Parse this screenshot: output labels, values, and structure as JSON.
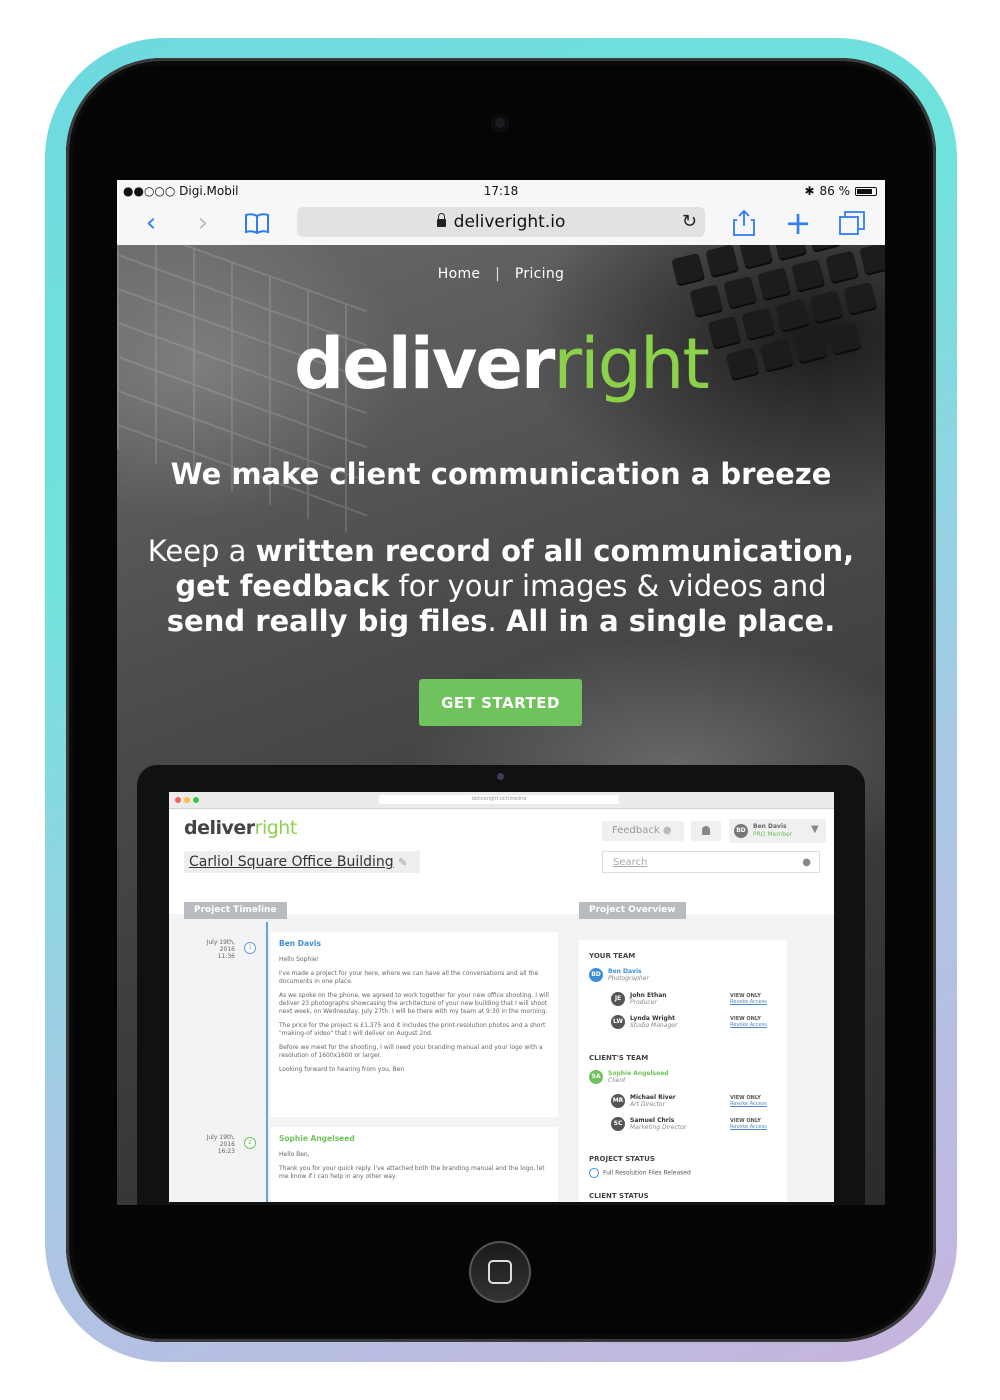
{
  "status_bar": {
    "carrier": "●●○○○ Digi.Mobil",
    "time": "17:18",
    "battery": "86 %",
    "battery_level": 0.86
  },
  "browser": {
    "url": "deliveright.io",
    "icons": [
      "back-icon",
      "forward-icon",
      "bookmarks-icon",
      "reload-icon",
      "share-icon",
      "new-tab-icon",
      "tabs-icon"
    ]
  },
  "nav": {
    "home": "Home",
    "separator": "|",
    "pricing": "Pricing"
  },
  "logo": {
    "part1": "deliver",
    "part2": "ight",
    "accent_color": "#8bd24a"
  },
  "hero": {
    "headline": "We make client communication a breeze",
    "sub_1": "Keep a ",
    "sub_2": "written record of all communication, get feedback",
    "sub_3": " for your images & videos and ",
    "sub_4": "send really big files",
    "sub_5": ". ",
    "sub_6": "All in a single place.",
    "cta": "GET STARTED",
    "cta_color": "#6fc25c"
  },
  "app": {
    "mac_url": "deliveright.io/timeline",
    "logo_part1": "deliver",
    "logo_part2": "ight",
    "feedback": "Feedback",
    "user_name": "Ben Davis",
    "user_role": "PRO Member",
    "user_initials": "BD",
    "project_title": "Carliol Square Office Building",
    "search_placeholder": "Search",
    "tab_timeline": "Project Timeline",
    "tab_overview": "Project Overview",
    "timeline": [
      {
        "date": "July 19th, 2016",
        "time": "11:36",
        "num": "1",
        "author": "Ben Davis",
        "lines": [
          "Hello Sophie!",
          "I've made a project for your here, where we can have all the conversations and all the documents in one place.",
          "As we spoke on the phone, we agreed to work together for your new office shooting. I will deliver 23 photographs showcasing the architecture of your new building that I will shoot next week, on Wednesday, July 27th. I will be there with my team at 9:30 in the morning.",
          "The price for the project is £1.375 and it includes the print-resolution photos and a short \"making-of video\" that I will deliver on August 2nd.",
          "Before we meet for the shooting, I will need your branding manual and your logo with a resolution of 1600x1600 or larger.",
          "Looking forward to hearing from you, Ben"
        ]
      },
      {
        "date": "July 19th, 2016",
        "time": "16:23",
        "num": "2",
        "author": "Sophie Angelseed",
        "lines": [
          "Hello Ben,",
          "Thank you for your quick reply. I've attached both the branding manual and the logo, let me know if I can help in any other way."
        ]
      }
    ],
    "overview": {
      "your_team": "YOUR TEAM",
      "clients_team": "CLIENT'S TEAM",
      "project_status": "PROJECT STATUS",
      "status_value": "Full Resolution Files Released",
      "client_status": "CLIENT STATUS",
      "view_only": "VIEW ONLY",
      "revoke": "Revoke Access",
      "team": [
        {
          "initials": "BD",
          "name": "Ben Davis",
          "role": "Photographer",
          "color": "#3b8fd6"
        },
        {
          "initials": "JE",
          "name": "John Ethan",
          "role": "Producer",
          "color": "#555"
        },
        {
          "initials": "LW",
          "name": "Lynda Wright",
          "role": "Studio Manager",
          "color": "#555"
        }
      ],
      "client_team": [
        {
          "initials": "SA",
          "name": "Sophie Angelseed",
          "role": "Client",
          "color": "#6fc25c"
        },
        {
          "initials": "MR",
          "name": "Michael River",
          "role": "Art Director",
          "color": "#555"
        },
        {
          "initials": "SC",
          "name": "Samuel Chris",
          "role": "Marketing Director",
          "color": "#555"
        }
      ]
    }
  }
}
